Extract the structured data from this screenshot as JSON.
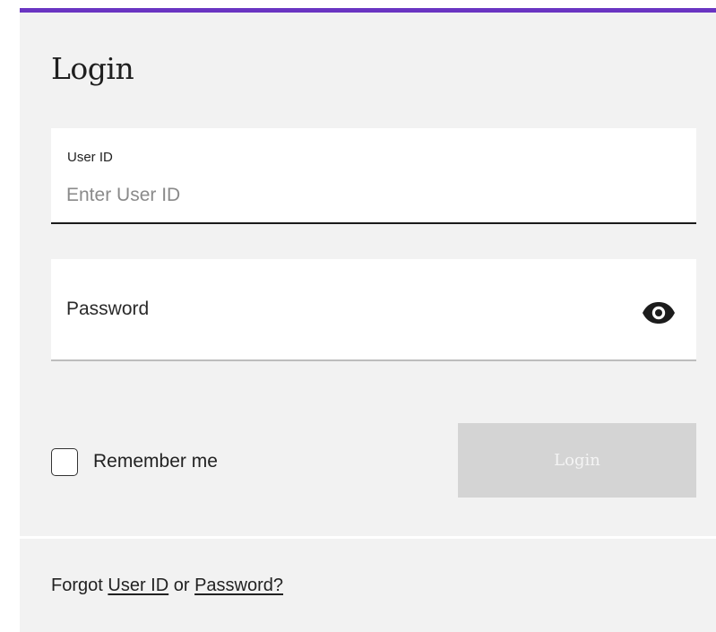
{
  "colors": {
    "accent": "#6a35c2",
    "panel_background": "#f2f2f2",
    "login_button_disabled": "#d4d4d4"
  },
  "form": {
    "title": "Login",
    "user_id": {
      "label": "User ID",
      "placeholder": "Enter User ID",
      "value": ""
    },
    "password": {
      "placeholder": "Password",
      "value": "",
      "toggle_icon": "eye-icon"
    },
    "remember_me": {
      "label": "Remember me",
      "checked": false
    },
    "login_button_label": "Login",
    "login_button_disabled": true
  },
  "footer": {
    "forgot_prefix": "Forgot",
    "user_id_link": "User ID",
    "or_text": "or",
    "password_link": "Password?"
  }
}
